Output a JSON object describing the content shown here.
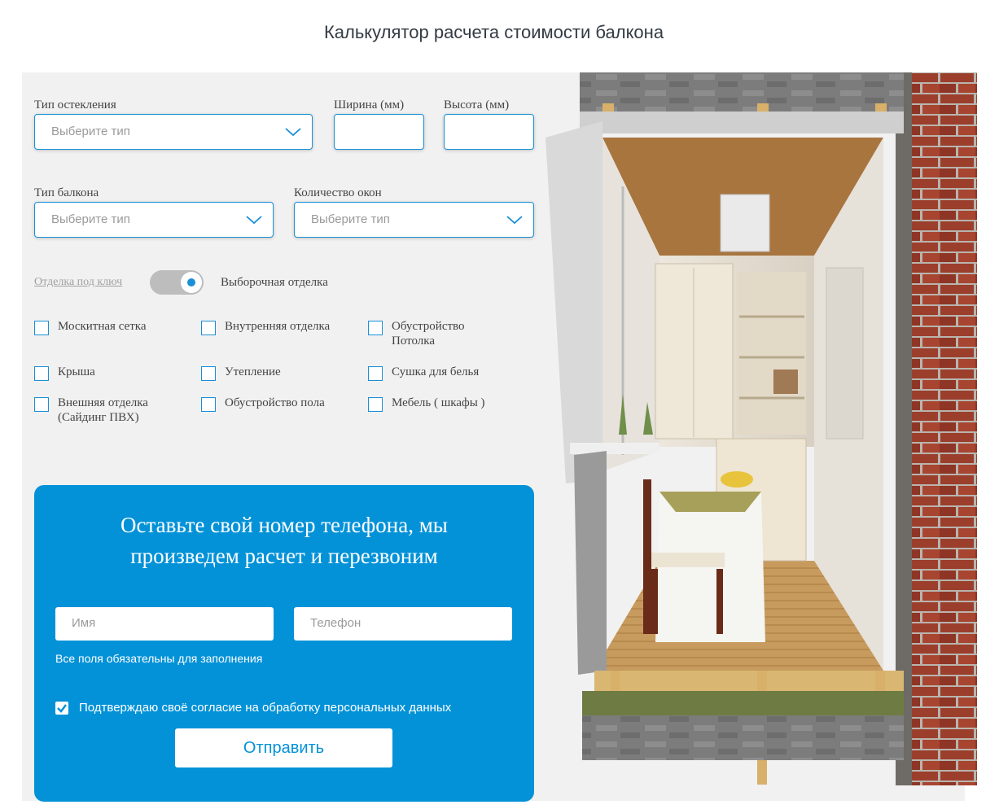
{
  "page": {
    "title": "Калькулятор расчета стоимости балкона"
  },
  "calculator": {
    "glazing": {
      "label": "Тип остекления",
      "placeholder": "Выберите тип"
    },
    "width": {
      "label": "Ширина (мм)",
      "value": ""
    },
    "height": {
      "label": "Высота (мм)",
      "value": ""
    },
    "balcony_type": {
      "label": "Тип балкона",
      "placeholder": "Выберите тип"
    },
    "windows_count": {
      "label": "Количество окон",
      "placeholder": "Выберите тип"
    },
    "finish_mode": {
      "left_label": "Отделка под ключ",
      "right_label": "Выборочная отделка",
      "selected": "right"
    },
    "options": [
      {
        "label": "Москитная сетка",
        "checked": false
      },
      {
        "label": "Внутренняя отделка",
        "checked": false
      },
      {
        "label": "Обустройство Потолка",
        "checked": false
      },
      {
        "label": "Крыша",
        "checked": false
      },
      {
        "label": "Утепление",
        "checked": false
      },
      {
        "label": "Сушка для белья",
        "checked": false
      },
      {
        "label": "Внешняя отделка (Сайдинг ПВХ)",
        "checked": false
      },
      {
        "label": "Обустройство пола",
        "checked": false
      },
      {
        "label": "Мебель ( шкафы )",
        "checked": false
      }
    ]
  },
  "callback_form": {
    "title_line1": "Оставьте свой номер телефона, мы",
    "title_line2": "произведем расчет и перезвоним",
    "name_placeholder": "Имя",
    "phone_placeholder": "Телефон",
    "required_note": "Все поля обязательны для заполнения",
    "consent_label": "Подтверждаю своё согласие на обработку персональных данных",
    "consent_checked": true,
    "submit_label": "Отправить"
  },
  "colors": {
    "accent": "#0392d8",
    "panel": "#f1f1f1"
  }
}
